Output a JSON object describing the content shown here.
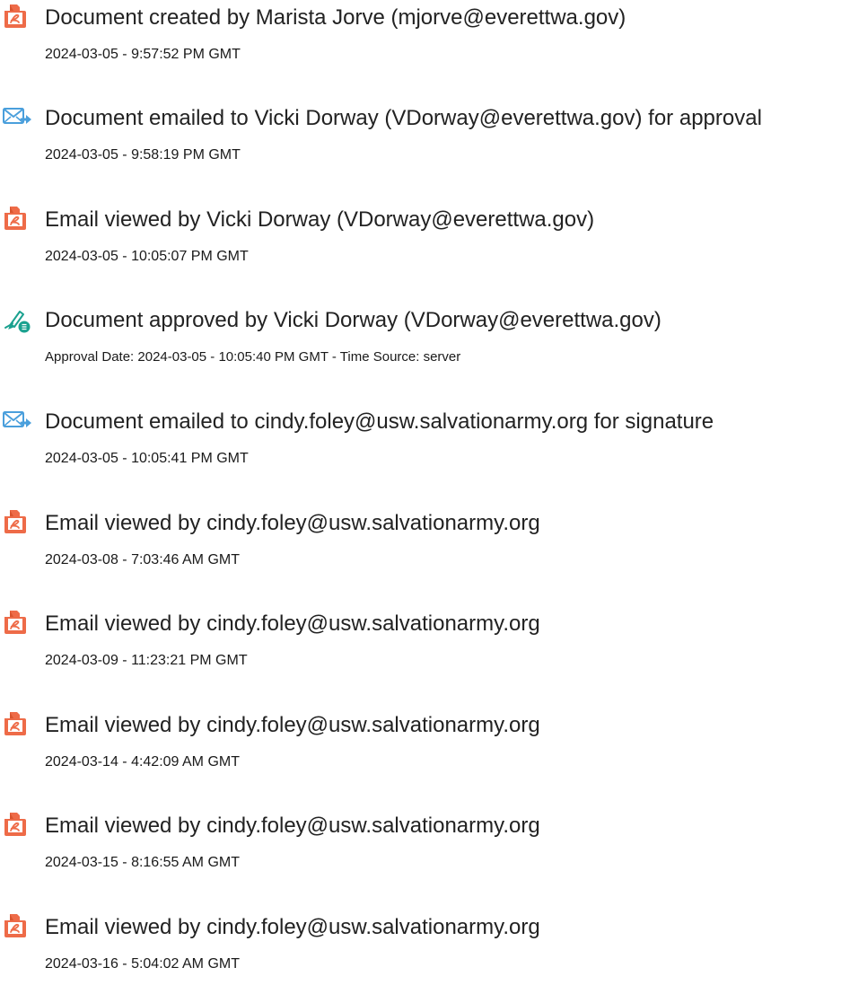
{
  "events": [
    {
      "icon": "document-created-icon",
      "title": "Document created by Marista Jorve (mjorve@everettwa.gov)",
      "detail": "2024-03-05 - 9:57:52 PM GMT"
    },
    {
      "icon": "email-sent-icon",
      "title": "Document emailed to Vicki Dorway (VDorway@everettwa.gov) for approval",
      "detail": "2024-03-05 - 9:58:19 PM GMT"
    },
    {
      "icon": "document-viewed-icon",
      "title": "Email viewed by Vicki Dorway (VDorway@everettwa.gov)",
      "detail": "2024-03-05 - 10:05:07 PM GMT"
    },
    {
      "icon": "approved-pen-icon",
      "title": "Document approved by Vicki Dorway (VDorway@everettwa.gov)",
      "detail": "Approval Date: 2024-03-05 - 10:05:40 PM GMT - Time Source: server"
    },
    {
      "icon": "email-sent-icon",
      "title": "Document emailed to cindy.foley@usw.salvationarmy.org for signature",
      "detail": "2024-03-05 - 10:05:41 PM GMT"
    },
    {
      "icon": "document-viewed-icon",
      "title": "Email viewed by cindy.foley@usw.salvationarmy.org",
      "detail": "2024-03-08 - 7:03:46 AM GMT"
    },
    {
      "icon": "document-viewed-icon",
      "title": "Email viewed by cindy.foley@usw.salvationarmy.org",
      "detail": "2024-03-09 - 11:23:21 PM GMT"
    },
    {
      "icon": "document-viewed-icon",
      "title": "Email viewed by cindy.foley@usw.salvationarmy.org",
      "detail": "2024-03-14 - 4:42:09 AM GMT"
    },
    {
      "icon": "document-viewed-icon",
      "title": "Email viewed by cindy.foley@usw.salvationarmy.org",
      "detail": "2024-03-15 - 8:16:55 AM GMT"
    },
    {
      "icon": "document-viewed-icon",
      "title": "Email viewed by cindy.foley@usw.salvationarmy.org",
      "detail": "2024-03-16 - 5:04:02 AM GMT"
    }
  ],
  "colors": {
    "document_icon": "#ee6b48",
    "email_icon": "#4a9fdc",
    "approve_icon": "#1aa18f",
    "text": "#222222"
  }
}
